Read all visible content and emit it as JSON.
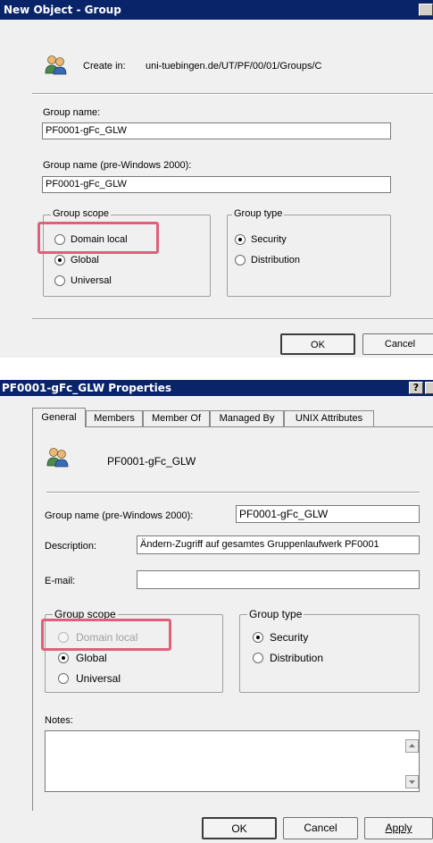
{
  "new_group_dialog": {
    "title": "New Object - Group",
    "create_in_label": "Create in:",
    "create_in_path": "uni-tuebingen.de/UT/PF/00/01/Groups/C",
    "group_name_label": "Group name:",
    "group_name_value": "PF0001-gFc_GLW",
    "prewin_label": "Group name (pre-Windows 2000):",
    "prewin_value": "PF0001-gFc_GLW",
    "scope": {
      "title": "Group scope",
      "options": [
        "Domain local",
        "Global",
        "Universal"
      ],
      "selected": "Global"
    },
    "type": {
      "title": "Group type",
      "options": [
        "Security",
        "Distribution"
      ],
      "selected": "Security"
    },
    "ok_label": "OK",
    "cancel_label": "Cancel"
  },
  "properties_dialog": {
    "title": "PF0001-gFc_GLW Properties",
    "help_glyph": "?",
    "tabs": [
      "General",
      "Members",
      "Member Of",
      "Managed By",
      "UNIX Attributes"
    ],
    "active_tab": "General",
    "group_name_display": "PF0001-gFc_GLW",
    "prewin_label": "Group name (pre-Windows 2000):",
    "prewin_value": "PF0001-gFc_GLW",
    "description_label": "Description:",
    "description_value": "Ändern-Zugriff auf gesamtes Gruppenlaufwerk PF0001",
    "email_label": "E-mail:",
    "email_value": "",
    "scope": {
      "title": "Group scope",
      "options": [
        "Domain local",
        "Global",
        "Universal"
      ],
      "selected": "Global",
      "disabled": [
        "Domain local"
      ]
    },
    "type": {
      "title": "Group type",
      "options": [
        "Security",
        "Distribution"
      ],
      "selected": "Security"
    },
    "notes_label": "Notes:",
    "notes_value": "",
    "ok_label": "OK",
    "cancel_label": "Cancel",
    "apply_label": "Apply"
  },
  "colors": {
    "titlebar": "#0a246a",
    "dialog_bg": "#f0f0f0",
    "highlight": "#e0607a"
  },
  "icons": [
    "users-group-icon",
    "radio-icon",
    "scroll-up-icon",
    "scroll-down-icon"
  ]
}
